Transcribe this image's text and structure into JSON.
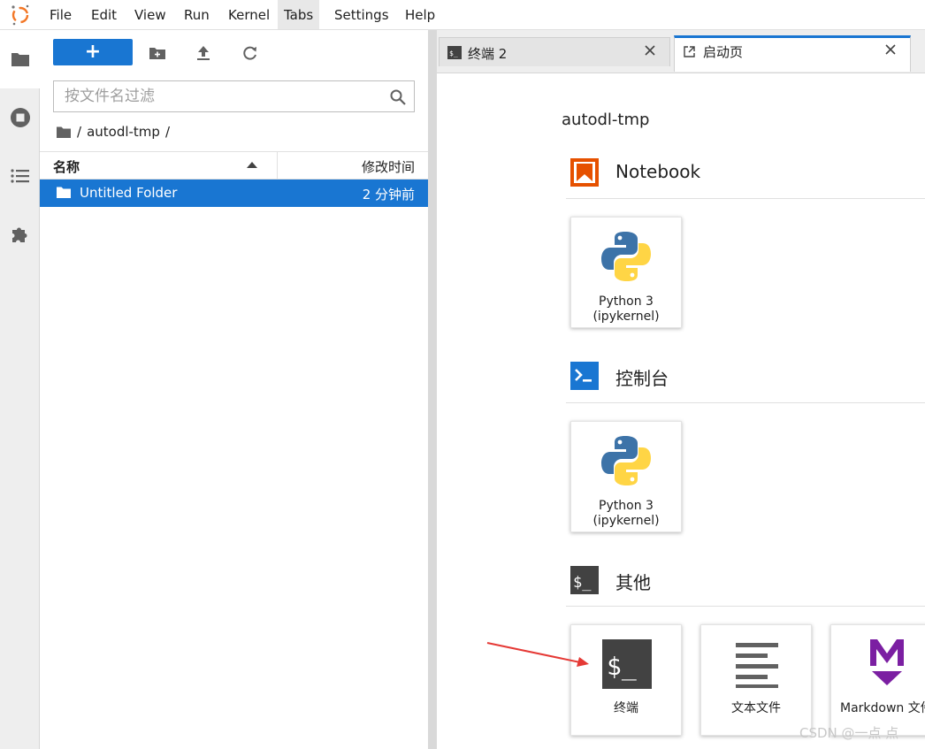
{
  "menubar": {
    "items": [
      "File",
      "Edit",
      "View",
      "Run",
      "Kernel",
      "Tabs",
      "Settings",
      "Help"
    ],
    "active": "Tabs"
  },
  "rail": {
    "icons": [
      "folder-icon",
      "stop-circle-icon",
      "list-icon",
      "puzzle-icon"
    ]
  },
  "filebrowser": {
    "new_label": "+",
    "filter_placeholder": "按文件名过滤",
    "breadcrumb": {
      "root_sep": "/",
      "folder": "autodl-tmp",
      "trail_sep": "/"
    },
    "columns": {
      "name": "名称",
      "modified": "修改时间"
    },
    "rows": [
      {
        "name": "Untitled Folder",
        "modified": "2 分钟前"
      }
    ]
  },
  "tabs": [
    {
      "label": "终端 2",
      "icon": "terminal-icon"
    },
    {
      "label": "启动页",
      "icon": "launcher-icon"
    }
  ],
  "launcher": {
    "cwd": "autodl-tmp",
    "sections": {
      "notebook": {
        "title": "Notebook",
        "cards": [
          {
            "line1": "Python 3",
            "line2": "(ipykernel)"
          }
        ]
      },
      "console": {
        "title": "控制台",
        "cards": [
          {
            "line1": "Python 3",
            "line2": "(ipykernel)"
          }
        ]
      },
      "other": {
        "title": "其他",
        "cards": [
          {
            "label": "终端"
          },
          {
            "label": "文本文件"
          },
          {
            "label": "Markdown 文件"
          }
        ]
      }
    }
  },
  "colors": {
    "accent": "#1976d2",
    "notebook_orange": "#e65100",
    "markdown_purple": "#7b1fa2",
    "annotation_red": "#e53935"
  },
  "watermark": "CSDN @一点 点"
}
